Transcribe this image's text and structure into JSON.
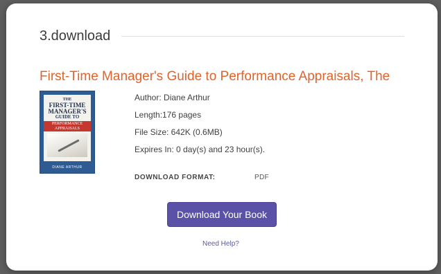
{
  "header": {
    "step_title": "3.download"
  },
  "book": {
    "title": "First-Time Manager's Guide to Performance Appraisals, The",
    "cover": {
      "the": "THE",
      "line1": "FIRST-TIME",
      "line2": "MANAGER'S",
      "line3": "GUIDE TO",
      "band": "PERFORMANCE APPRAISALS",
      "author": "DIANE ARTHUR"
    },
    "author": "Author: Diane Arthur",
    "length": "Length:176 pages",
    "file_size": "File Size: 642K (0.6MB)",
    "expires": "Expires In: 0 day(s) and 23 hour(s)."
  },
  "format": {
    "label": "DOWNLOAD FORMAT:",
    "value": "PDF"
  },
  "actions": {
    "download_label": "Download Your Book",
    "help_label": "Need Help?"
  },
  "colors": {
    "accent_title": "#e0632a",
    "button": "#5b52a8",
    "backdrop": "#5e5e5e"
  }
}
